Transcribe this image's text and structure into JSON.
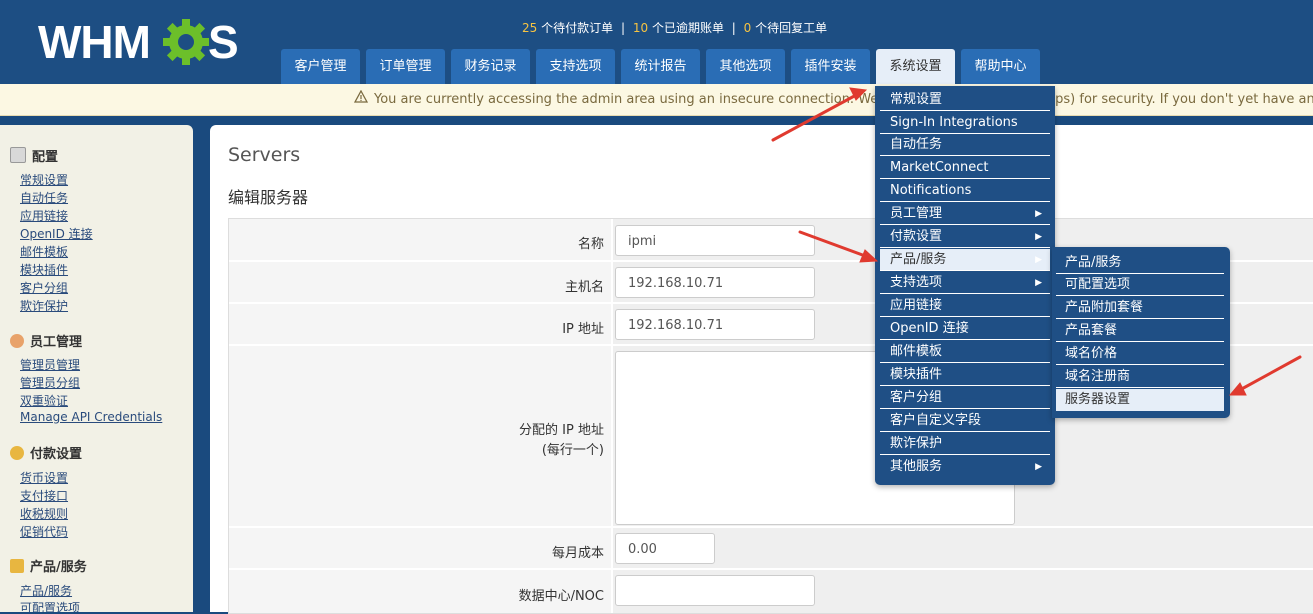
{
  "logo_text": "WHMCS",
  "stats": {
    "pending_orders_count": "25",
    "pending_orders_label": "个待付款订单",
    "overdue_count": "10",
    "overdue_label": "个已逾期账单",
    "tickets_count": "0",
    "tickets_label": "个待回复工单",
    "separator": "|"
  },
  "nav": [
    "客户管理",
    "订单管理",
    "财务记录",
    "支持选项",
    "统计报告",
    "其他选项",
    "插件安装",
    "系统设置",
    "帮助中心"
  ],
  "warning": "You are currently accessing the admin area using an insecure connection. We recommend using SSL (https) for security. If you don't yet have an SSL certificate",
  "sidebar": {
    "sections": [
      {
        "title": "配置",
        "links": [
          "常规设置",
          "自动任务",
          "应用链接",
          "OpenID 连接",
          "邮件模板",
          "模块插件",
          "客户分组",
          "欺诈保护"
        ]
      },
      {
        "title": "员工管理",
        "links": [
          "管理员管理",
          "管理员分组",
          "双重验证",
          "Manage API Credentials"
        ]
      },
      {
        "title": "付款设置",
        "links": [
          "货币设置",
          "支付接口",
          "收税规则",
          "促销代码"
        ]
      },
      {
        "title": "产品/服务",
        "links": [
          "产品/服务",
          "可配置选项"
        ]
      }
    ]
  },
  "page": {
    "title": "Servers",
    "subtitle": "编辑服务器"
  },
  "form": {
    "name_label": "名称",
    "name_value": "ipmi",
    "hostname_label": "主机名",
    "hostname_value": "192.168.10.71",
    "ip_label": "IP 地址",
    "ip_value": "192.168.10.71",
    "assigned_ip_label": "分配的 IP 地址",
    "assigned_ip_hint": "(每行一个)",
    "assigned_ip_value": "",
    "monthly_cost_label": "每月成本",
    "monthly_cost_value": "0.00",
    "datacenter_label": "数据中心/NOC",
    "datacenter_value": ""
  },
  "dropdown": [
    "常规设置",
    "Sign-In Integrations",
    "自动任务",
    "MarketConnect",
    "Notifications",
    "员工管理",
    "付款设置",
    "产品/服务",
    "支持选项",
    "应用链接",
    "OpenID 连接",
    "邮件模板",
    "模块插件",
    "客户分组",
    "客户自定义字段",
    "欺诈保护",
    "其他服务"
  ],
  "submenu": [
    "产品/服务",
    "可配置选项",
    "产品附加套餐",
    "产品套餐",
    "域名价格",
    "域名注册商",
    "服务器设置"
  ],
  "colors": {
    "header": "#1d4e83",
    "nav_tab": "#2a6db5",
    "stat_highlight": "#f6c342",
    "annotation_arrow": "#e03a2f"
  }
}
